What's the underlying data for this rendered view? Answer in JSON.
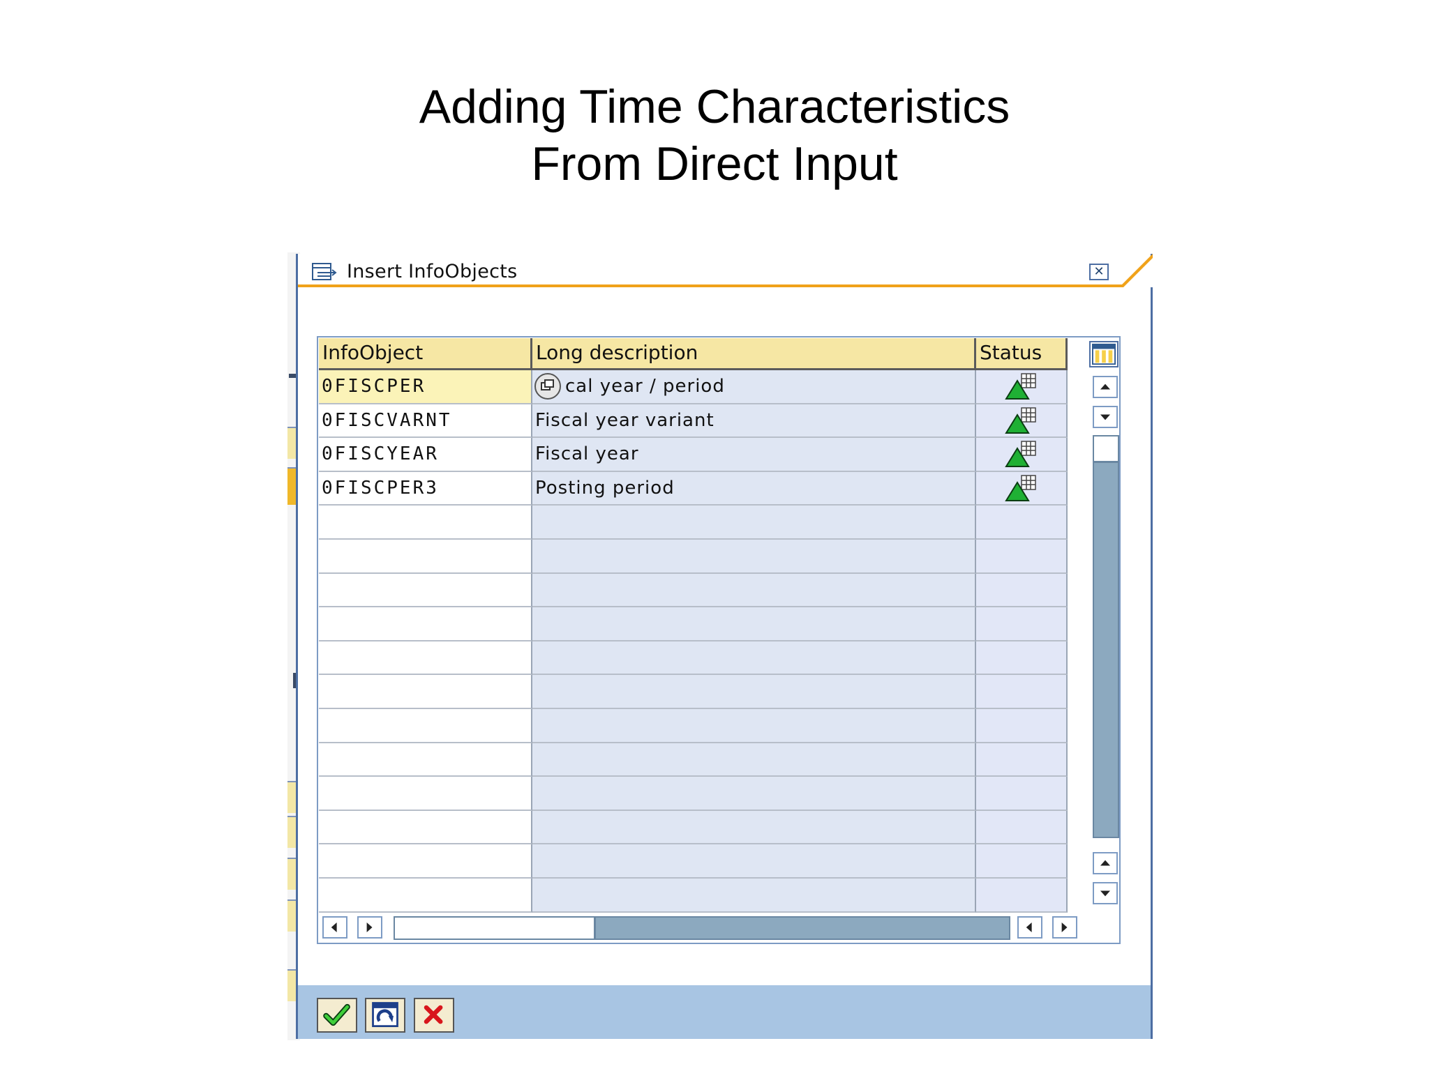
{
  "slide": {
    "title_line1": "Adding Time Characteristics",
    "title_line2": "From Direct Input"
  },
  "dialog": {
    "title": "Insert InfoObjects",
    "close_icon": "close-icon"
  },
  "table": {
    "columns": [
      "InfoObject",
      "Long description",
      "Status"
    ],
    "rows": [
      {
        "infoobject": "0FISCPER",
        "description": "cal year / period",
        "status_icon": "active-status-icon",
        "selected": true
      },
      {
        "infoobject": "0FISCVARNT",
        "description": "Fiscal year variant",
        "status_icon": "active-status-icon"
      },
      {
        "infoobject": "0FISCYEAR",
        "description": "Fiscal year",
        "status_icon": "active-status-icon"
      },
      {
        "infoobject": "0FISCPER3",
        "description": "Posting period",
        "status_icon": "active-status-icon"
      }
    ],
    "empty_rows": 12
  },
  "footer": {
    "buttons": [
      "confirm-check-icon",
      "refresh-icon",
      "cancel-x-icon"
    ]
  },
  "colors": {
    "header_bg": "#f6e7a4",
    "accent_orange": "#f0a21a",
    "frame_blue": "#4d6ea3",
    "footer_bg": "#a8c5e3"
  }
}
